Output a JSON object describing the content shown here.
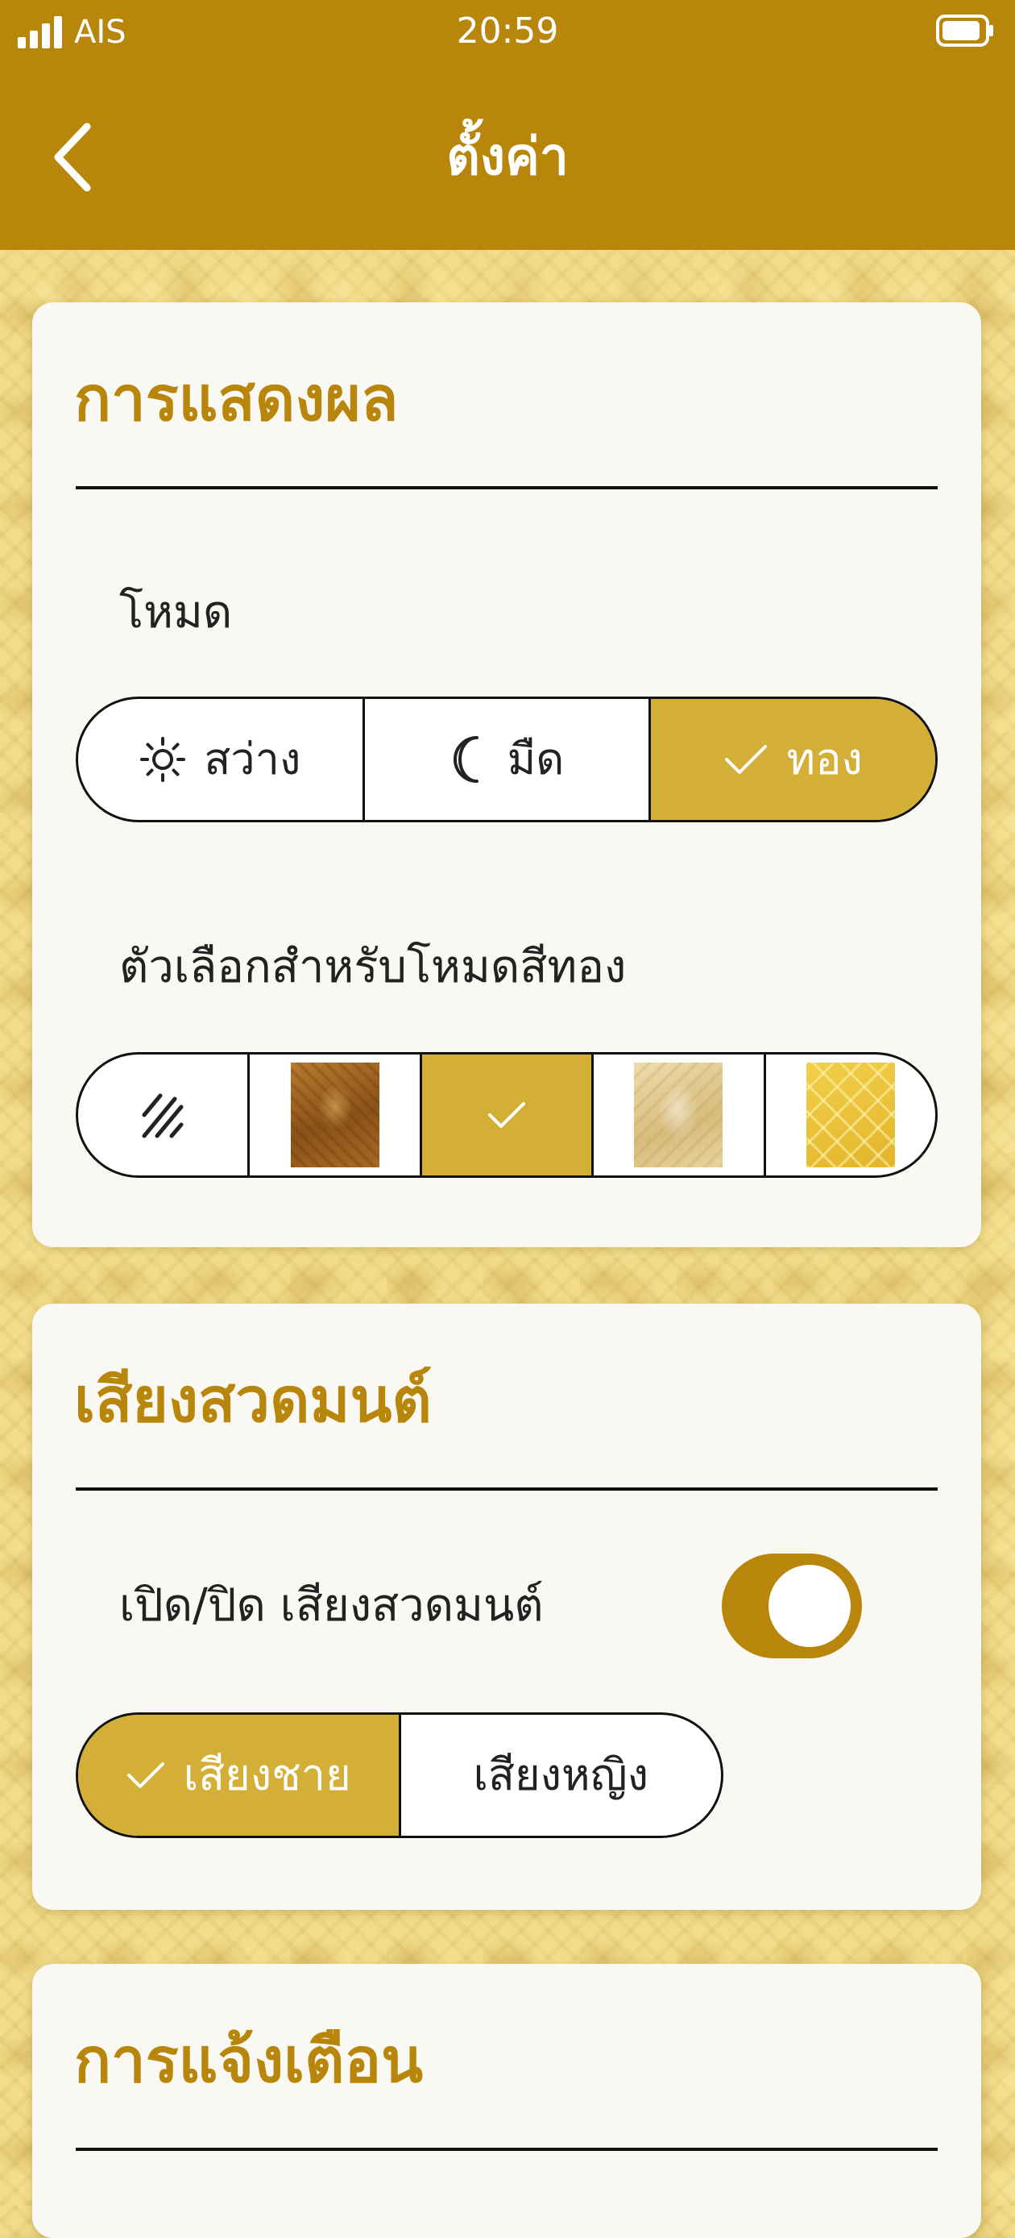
{
  "status_bar": {
    "carrier": "AIS",
    "time": "20:59"
  },
  "nav": {
    "title": "ตั้งค่า"
  },
  "display": {
    "title": "การแสดงผล",
    "mode_label": "โหมด",
    "modes": [
      {
        "label": "สว่าง",
        "icon": "sun-icon",
        "selected": false
      },
      {
        "label": "มืด",
        "icon": "moon-icon",
        "selected": false
      },
      {
        "label": "ทอง",
        "icon": "check-icon",
        "selected": true
      }
    ],
    "gold_options_label": "ตัวเลือกสำหรับโหมดสีทอง",
    "gold_options": [
      {
        "name": "no-pattern",
        "selected": false
      },
      {
        "name": "brown-ornate",
        "selected": false
      },
      {
        "name": "plain-gold",
        "selected": true
      },
      {
        "name": "cream-ornate",
        "selected": false
      },
      {
        "name": "gold-diamond",
        "selected": false
      }
    ]
  },
  "chant": {
    "title": "เสียงสวดมนต์",
    "toggle_label": "เปิด/ปิด เสียงสวดมนต์",
    "toggle_on": true,
    "voices": [
      {
        "label": "เสียงชาย",
        "selected": true
      },
      {
        "label": "เสียงหญิง",
        "selected": false
      }
    ]
  },
  "notifications": {
    "title": "การแจ้งเตือน"
  },
  "colors": {
    "header": "#b8860b",
    "accent_gold": "#d4af37",
    "title_gold": "#b8860b",
    "card": "#faf8f3"
  }
}
